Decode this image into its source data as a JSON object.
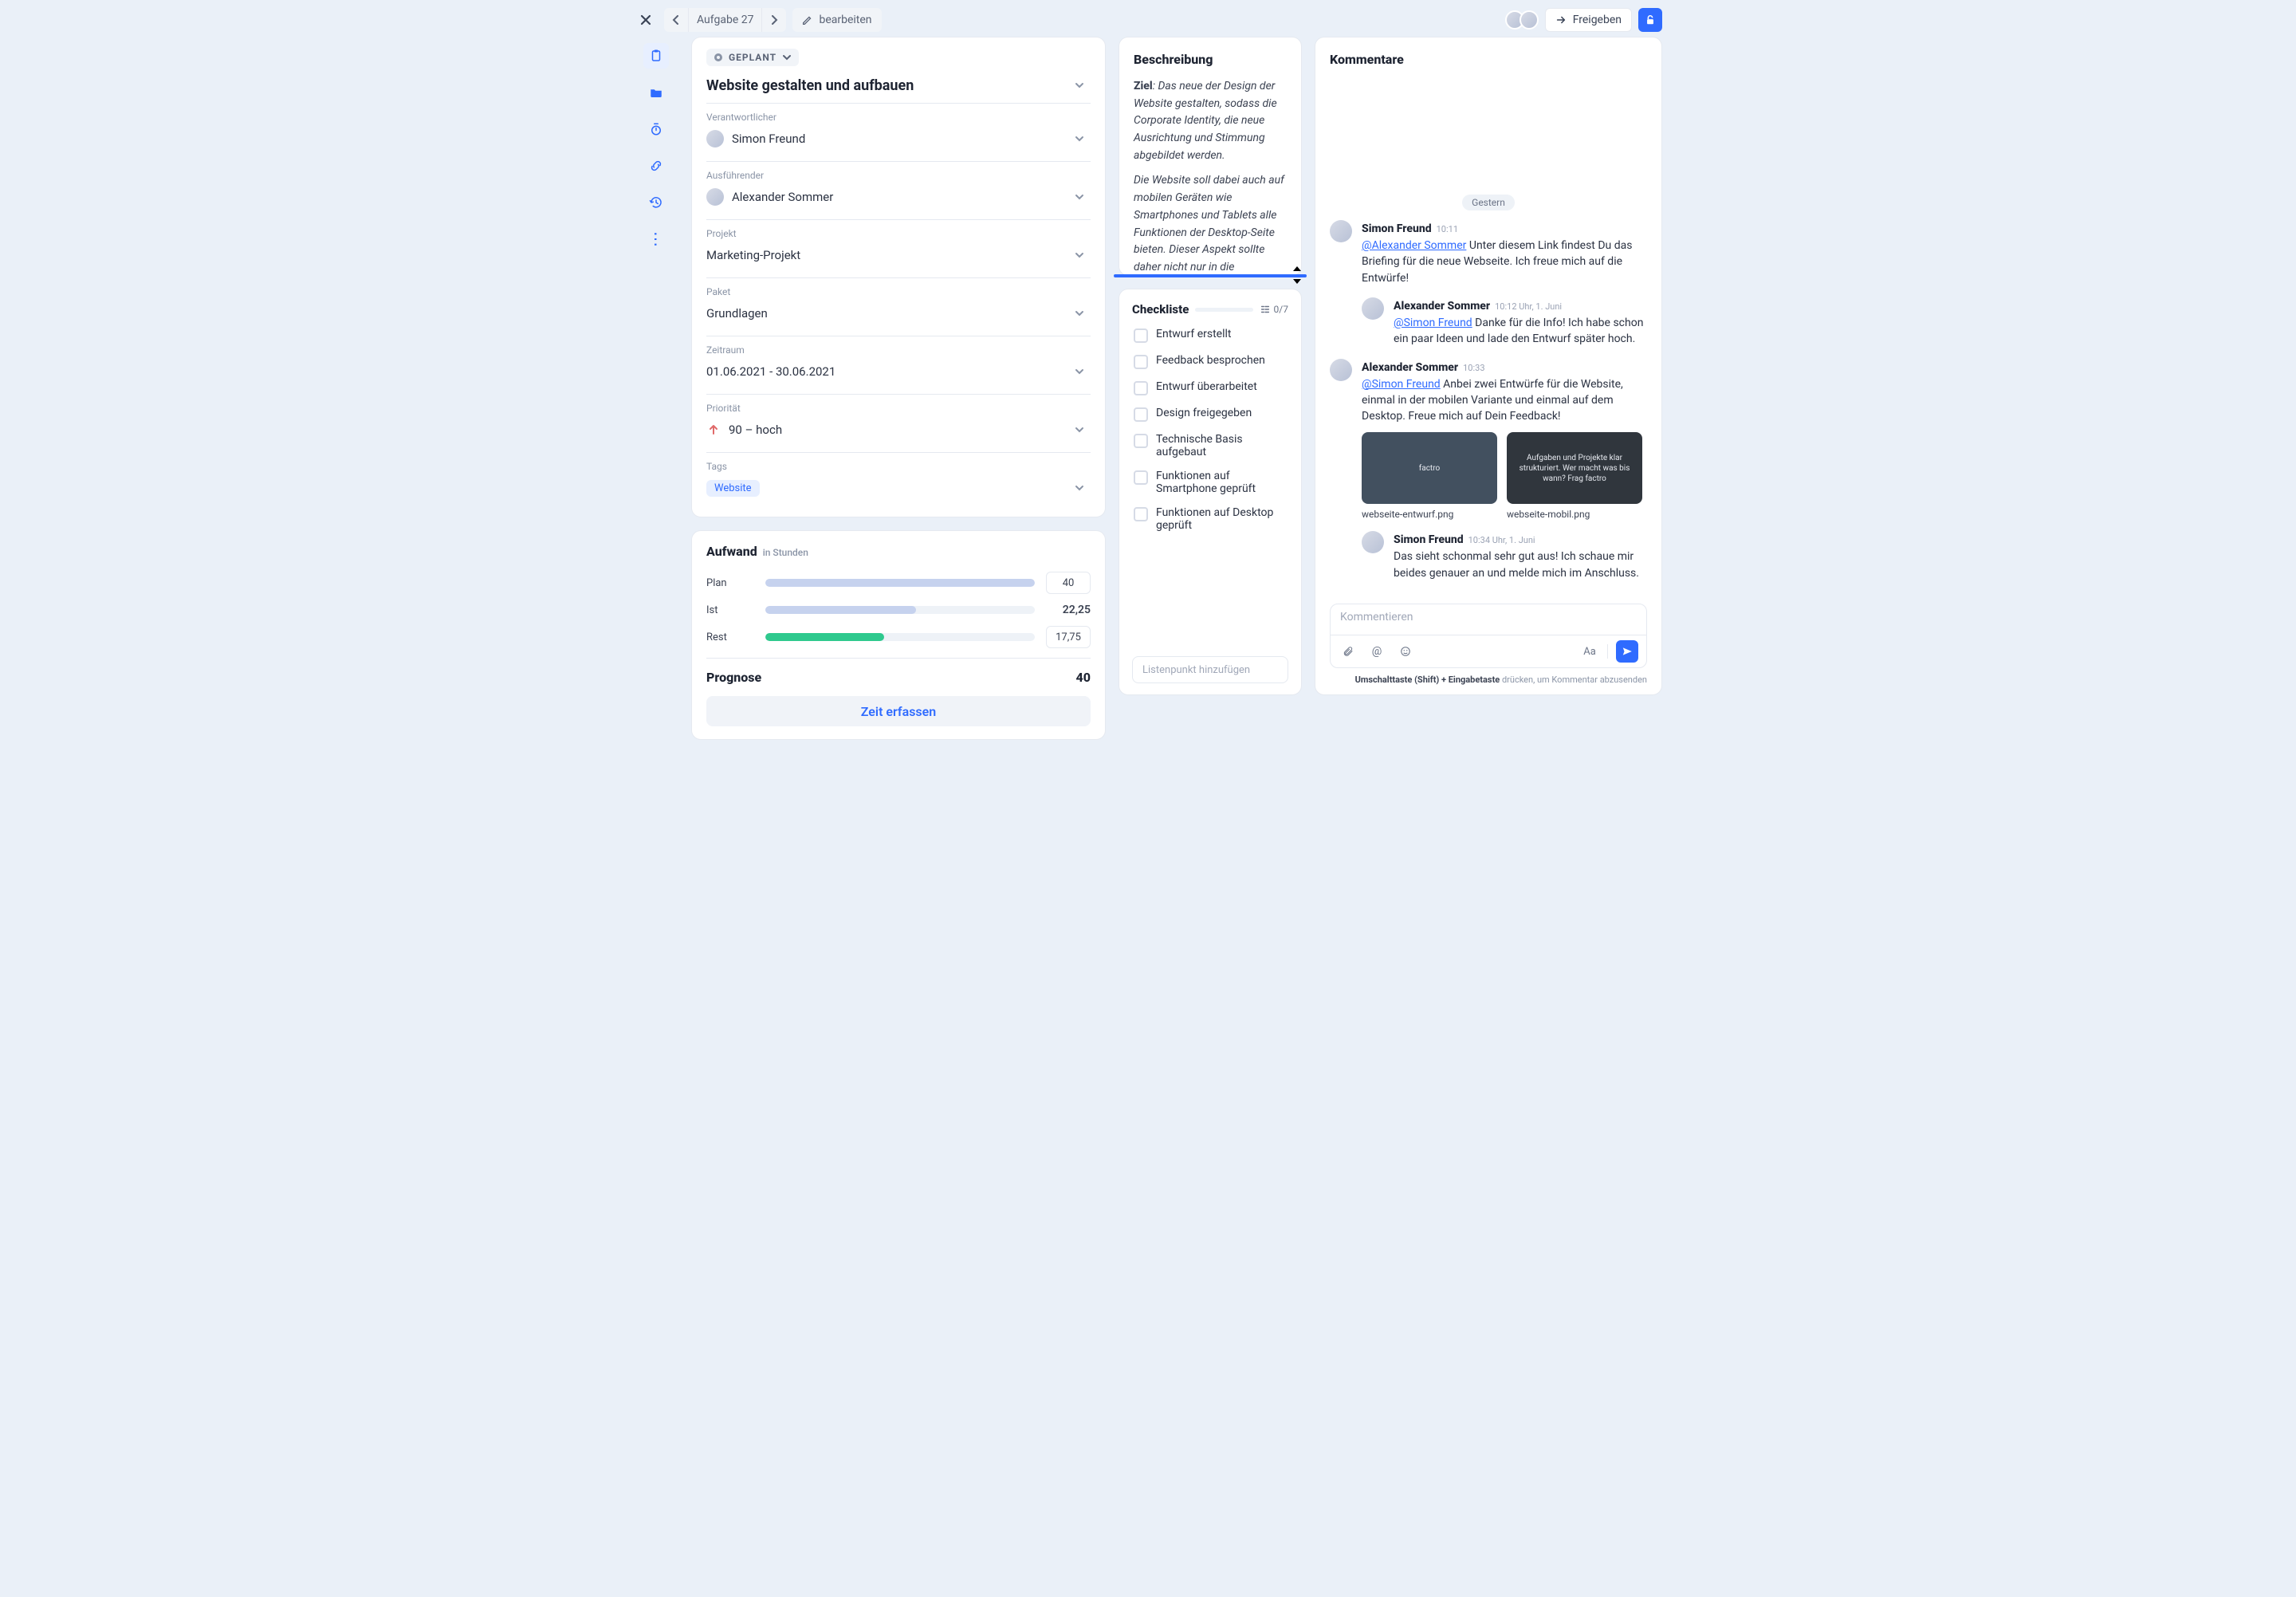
{
  "topbar": {
    "task_id": "Aufgabe 27",
    "edit_label": "bearbeiten",
    "share_label": "Freigeben"
  },
  "sidebar": {
    "icons": [
      "clipboard",
      "folder",
      "stopwatch",
      "link",
      "history",
      "more"
    ]
  },
  "task": {
    "status": "GEPLANT",
    "title": "Website gestalten und aufbauen",
    "fields": {
      "responsible": {
        "label": "Verantwortlicher",
        "value": "Simon Freund"
      },
      "executor": {
        "label": "Ausführender",
        "value": "Alexander Sommer"
      },
      "project": {
        "label": "Projekt",
        "value": "Marketing-Projekt"
      },
      "package": {
        "label": "Paket",
        "value": "Grundlagen"
      },
      "period": {
        "label": "Zeitraum",
        "value": "01.06.2021 - 30.06.2021"
      },
      "priority": {
        "label": "Priorität",
        "value": "90 – hoch"
      },
      "tags": {
        "label": "Tags",
        "value": "Website"
      }
    }
  },
  "effort": {
    "title": "Aufwand",
    "subtitle": "in Stunden",
    "rows": {
      "plan": {
        "label": "Plan",
        "value": "40",
        "percent": 100
      },
      "ist": {
        "label": "Ist",
        "value": "22,25",
        "percent": 56
      },
      "rest": {
        "label": "Rest",
        "value": "17,75",
        "percent": 44
      }
    },
    "prognosis": {
      "label": "Prognose",
      "value": "40"
    },
    "time_button": "Zeit erfassen"
  },
  "description": {
    "title": "Beschreibung",
    "goal_label": "Ziel",
    "para1": ": Das neue der Design der Website gestalten, sodass die Corporate Identity, die neue Ausrichtung und Stimmung abgebildet werden.",
    "para2": "Die Website soll dabei auch auf mobilen Geräten wie Smartphones und Tablets alle Funktionen der Desktop-Seite bieten. Dieser Aspekt sollte daher nicht nur in die technische Umsetzung, sondern auch in das"
  },
  "checklist": {
    "title": "Checkliste",
    "count": "0/7",
    "items": [
      "Entwurf erstellt",
      "Feedback besprochen",
      "Entwurf überarbeitet",
      "Design freigegeben",
      "Technische Basis aufgebaut",
      "Funktionen auf Smartphone geprüft",
      "Funktionen auf Desktop geprüft"
    ],
    "add_placeholder": "Listenpunkt hinzufügen"
  },
  "comments": {
    "title": "Kommentare",
    "day": "Gestern",
    "input_placeholder": "Kommentieren",
    "hint_bold": "Umschalttaste (Shift) + Eingabetaste",
    "hint_rest": " drücken, um Kommentar abzusenden",
    "messages": [
      {
        "author": "Simon Freund",
        "time": "10:11",
        "mention": "@Alexander Sommer",
        "text": " Unter diesem Link findest Du das Briefing für die neue Webseite. Ich freue mich auf die Entwürfe!",
        "reply": false
      },
      {
        "author": "Alexander Sommer",
        "time": "10:12 Uhr, 1. Juni",
        "mention": "@Simon Freund",
        "text": " Danke für die Info! Ich habe schon ein paar Ideen und lade den Entwurf später hoch.",
        "reply": true
      },
      {
        "author": "Alexander Sommer",
        "time": "10:33",
        "mention": "@Simon Freund",
        "text": " Anbei zwei Entwürfe für die Website, einmal in der mobilen Variante und einmal auf dem Desktop. Freue mich auf Dein Feedback!",
        "reply": false,
        "attachments": [
          {
            "file": "webseite-entwurf.png",
            "preview": "factro"
          },
          {
            "file": "webseite-mobil.png",
            "preview": "Aufgaben und Projekte klar strukturiert. Wer macht was bis wann? Frag factro"
          }
        ]
      },
      {
        "author": "Simon Freund",
        "time": "10:34 Uhr, 1. Juni",
        "mention": "",
        "text": "Das sieht schonmal sehr gut aus! Ich schaue mir beides genauer an und melde mich im Anschluss.",
        "reply": true
      }
    ]
  }
}
